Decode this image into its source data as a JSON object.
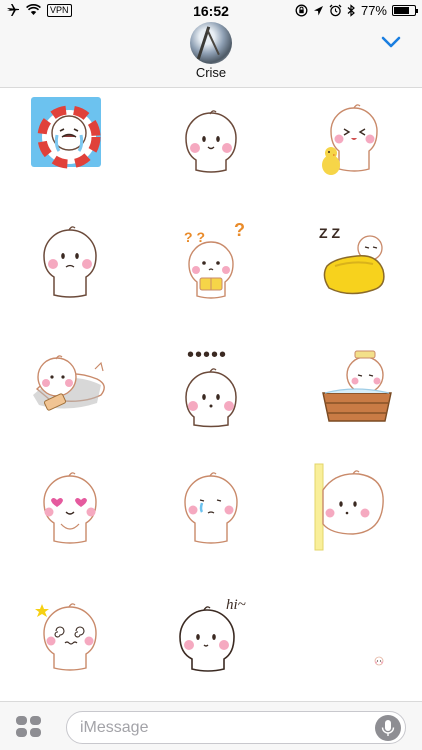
{
  "status_bar": {
    "time": "16:52",
    "vpn_label": "VPN",
    "battery": "77%",
    "battery_level": 0.77,
    "icons": [
      "airplane-icon",
      "wifi-icon",
      "rotation-lock-icon",
      "location-icon",
      "alarm-icon",
      "bluetooth-icon",
      "battery-icon"
    ]
  },
  "header": {
    "contact_name": "Crise",
    "avatar_icon": "photo-avatar",
    "collapse_icon": "chevron-down-icon"
  },
  "stickers": [
    {
      "name": "sticker-life-ring-crying",
      "selected": true
    },
    {
      "name": "sticker-smiling"
    },
    {
      "name": "sticker-laughing-with-chick"
    },
    {
      "name": "sticker-sad"
    },
    {
      "name": "sticker-reading-confused"
    },
    {
      "name": "sticker-sleeping-zzz"
    },
    {
      "name": "sticker-lying-phone"
    },
    {
      "name": "sticker-speechless-dots"
    },
    {
      "name": "sticker-bath-tub"
    },
    {
      "name": "sticker-heart-eyes"
    },
    {
      "name": "sticker-crying-tear"
    },
    {
      "name": "sticker-peeking-wall"
    },
    {
      "name": "sticker-dizzy"
    },
    {
      "name": "sticker-hi-waving"
    },
    {
      "name": "sticker-tiny-face"
    }
  ],
  "sticker_texts": {
    "hi": "hi~",
    "zzz": "Z Z",
    "dots": "•••••"
  },
  "compose": {
    "placeholder": "iMessage",
    "value": "",
    "apps_icon": "app-drawer-icon",
    "mic_icon": "microphone-icon"
  },
  "colors": {
    "accent": "#1a7ee0",
    "bar_bg": "#f7f7f7",
    "selected_sticker_bg": "#6cc2ef",
    "blush": "#f5a9c0"
  }
}
